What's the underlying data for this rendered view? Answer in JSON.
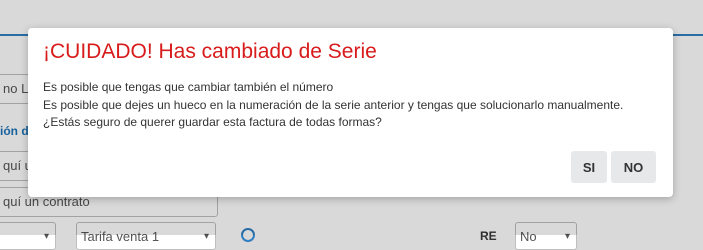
{
  "dialog": {
    "title": "¡CUIDADO! Has cambiado de Serie",
    "line1": "Es posible que tengas que cambiar también el número",
    "line2": "Es posible que dejes un hueco en la numeración de la serie anterior y tengas que solucionarlo manualmente. ¿Estás seguro de querer guardar esta factura de todas formas?",
    "yes_label": "SI",
    "no_label": "NO"
  },
  "background": {
    "field1_value": "no Ló",
    "link_text": "ión d",
    "field2_placeholder": "quí un",
    "field3_placeholder": "quí un contrato",
    "select1_value": "",
    "select2_value": "Tarifa venta 1",
    "label_re": "RE",
    "select3_value": "No"
  },
  "colors": {
    "title_red": "#d81b1b",
    "accent_blue": "#2f7fc1",
    "button_bg": "#e6e8ea"
  }
}
